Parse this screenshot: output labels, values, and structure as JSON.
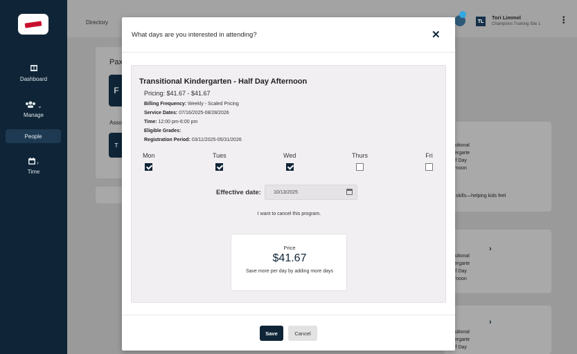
{
  "sidebar": {
    "logo_icon": "brand-logo",
    "items": [
      {
        "label": "Dashboard",
        "icon": "dashboard-icon"
      },
      {
        "label": "Manage",
        "icon": "people-group-icon"
      },
      {
        "label": "People"
      },
      {
        "label": "Time",
        "icon": "calendar-icon"
      }
    ]
  },
  "topbar": {
    "breadcrumb": "Directory",
    "user": {
      "initials": "TL",
      "name": "Tori Limmel",
      "site": "Champions Training Site 1"
    }
  },
  "background": {
    "pax_prefix": "Pax",
    "chip1_letter": "F",
    "asso_prefix": "Asso",
    "chip2_letter": "T",
    "card1_lines": [
      "sitional",
      "ergarte",
      "lf Day",
      "rnoon"
    ],
    "card1_desc": "skills—helping kids feel",
    "card2_lines": [
      "sitional",
      "ergarte",
      "lf Day",
      "rnoon"
    ],
    "card3_lines": [
      "sitional",
      "ergarte",
      "lf Day"
    ]
  },
  "modal": {
    "title": "What days are you interested in attending?",
    "program": {
      "title": "Transitional Kindergarten - Half Day Afternoon",
      "pricing": "Pricing: $41.67 - $41.67",
      "billing_label": "Billing Frequency:",
      "billing_value": "Weekly - Scaled Pricing",
      "service_label": "Service Dates:",
      "service_value": "07/16/2025-08/28/2026",
      "time_label": "Time:",
      "time_value": "12:00 pm-6:00 pm",
      "grades_label": "Eligible Grades:",
      "grades_value": "",
      "registration_label": "Registration Period:",
      "registration_value": "03/11/2025-05/31/2026"
    },
    "days": [
      {
        "label": "Mon",
        "checked": true
      },
      {
        "label": "Tues",
        "checked": true
      },
      {
        "label": "Wed",
        "checked": true
      },
      {
        "label": "Thurs",
        "checked": false
      },
      {
        "label": "Fri",
        "checked": false
      }
    ],
    "effective_label": "Effective date:",
    "effective_value": "10/13/2025",
    "cancel_link": "I want to cancel this program.",
    "price_label": "Price",
    "price_value": "$41.67",
    "price_note": "Save more per day by adding more days",
    "save_label": "Save",
    "cancel_label": "Cancel"
  },
  "colors": {
    "primary": "#0f2537",
    "notification": "#33a8e0"
  }
}
